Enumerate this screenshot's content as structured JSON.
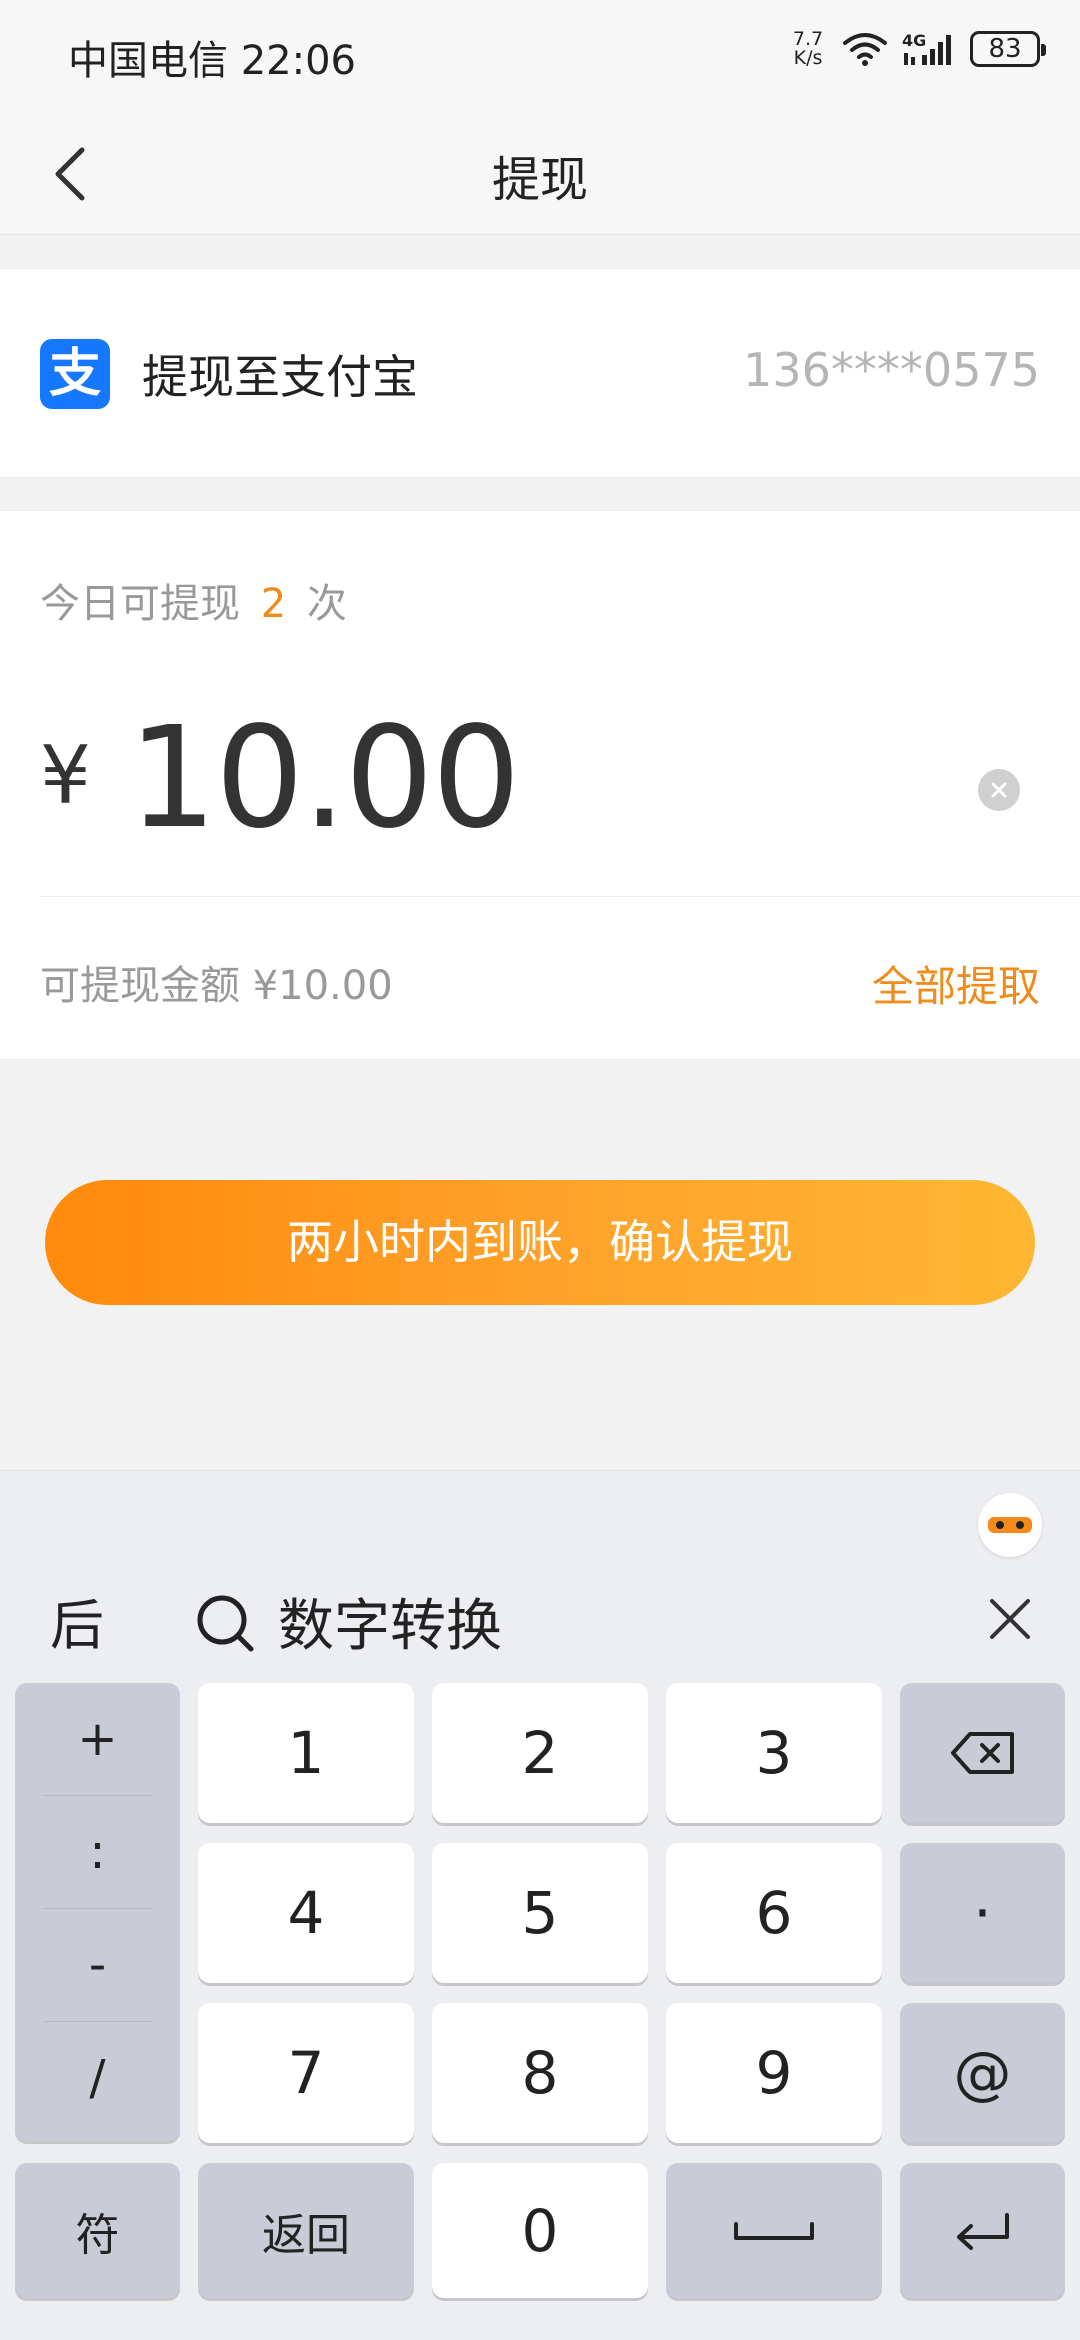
{
  "status_bar": {
    "carrier": "中国电信",
    "time": "22:06",
    "net_speed_top": "7.7",
    "net_speed_bottom": "K/s",
    "network_type": "4G",
    "battery": "83"
  },
  "nav": {
    "title": "提现"
  },
  "payout_account": {
    "label": "提现至支付宝",
    "account": "136****0575",
    "logo_glyph": "支",
    "logo_color": "#1677ff"
  },
  "withdraw": {
    "times_prefix": "今日可提现",
    "times_count": "2",
    "times_suffix": "次",
    "currency": "¥",
    "amount": "10.00",
    "available_label": "可提现金额 ¥10.00",
    "withdraw_all": "全部提取",
    "accent_color": "#f08c1c"
  },
  "confirm_button": {
    "label": "两小时内到账，确认提现"
  },
  "keyboard": {
    "back_label": "后",
    "search_label": "数字转换",
    "symbols": [
      "+",
      ":",
      "-",
      "/"
    ],
    "digits": [
      "1",
      "2",
      "3",
      "4",
      "5",
      "6",
      "7",
      "8",
      "9"
    ],
    "zero": "0",
    "dot": "·",
    "at": "@",
    "symbol_switch": "符",
    "return_label": "返回"
  }
}
